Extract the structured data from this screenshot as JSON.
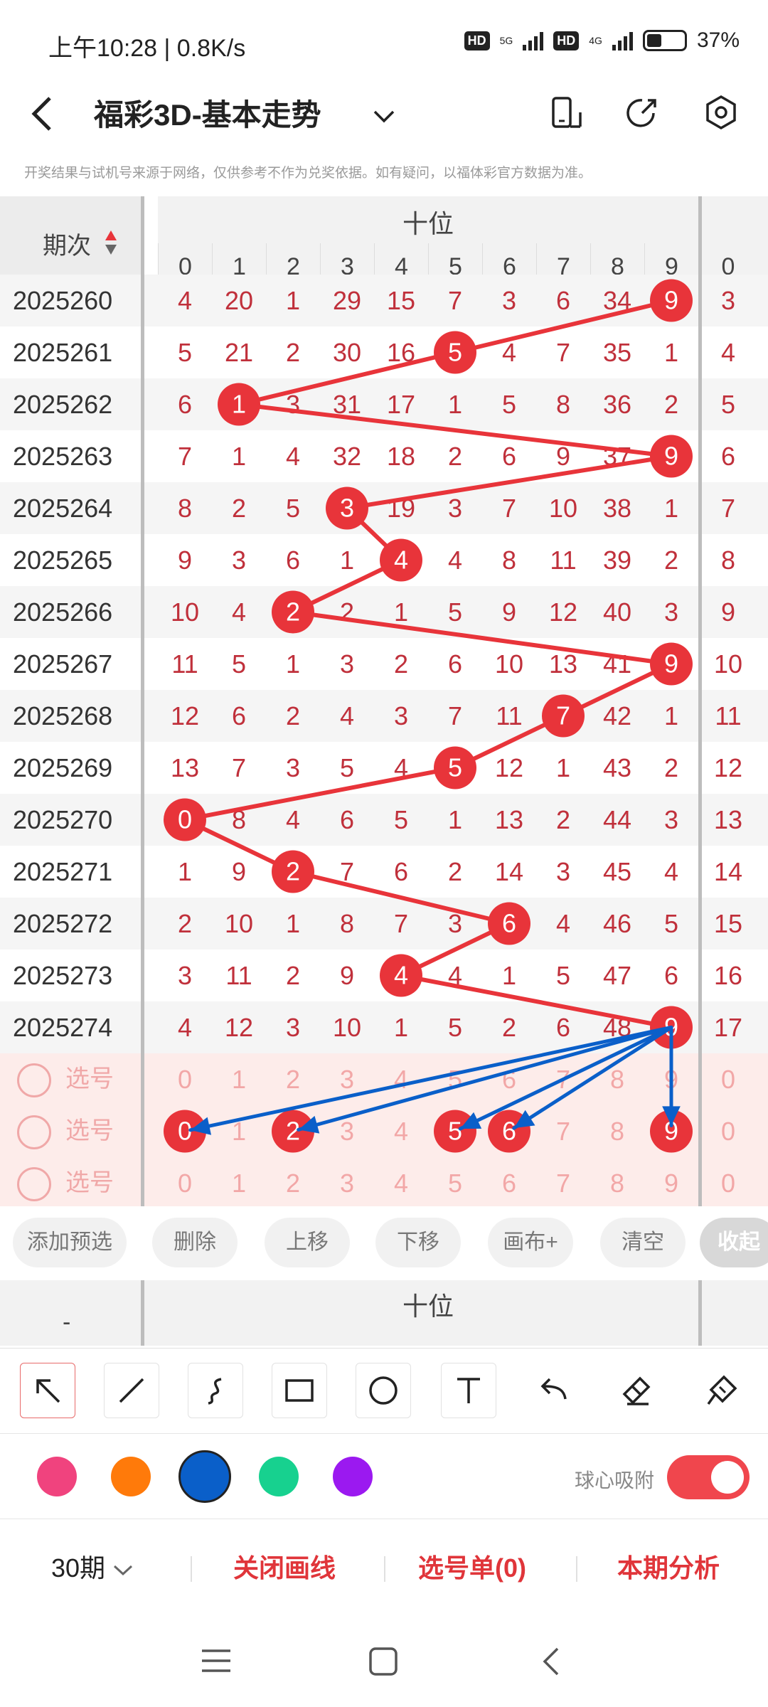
{
  "status": {
    "time": "上午10:28 | 0.8K/s",
    "hd": "HD",
    "net5g": "5G",
    "net4g": "4G",
    "battery": "37%"
  },
  "header": {
    "title": "福彩3D-基本走势"
  },
  "notice": "开奖结果与试机号来源于网络，仅供参考不作为兑奖依据。如有疑问，以福体彩官方数据为准。",
  "table": {
    "period_col_label": "期次",
    "zone_title": "十位",
    "digits": [
      "0",
      "1",
      "2",
      "3",
      "4",
      "5",
      "6",
      "7",
      "8",
      "9"
    ],
    "next_zone_first_digit": "0",
    "rows": [
      {
        "period": "2025260",
        "cells": [
          "4",
          "20",
          "1",
          "29",
          "15",
          "7",
          "3",
          "6",
          "34",
          "9"
        ],
        "extra": "3",
        "hit": 9
      },
      {
        "period": "2025261",
        "cells": [
          "5",
          "21",
          "2",
          "30",
          "16",
          "5",
          "4",
          "7",
          "35",
          "1"
        ],
        "extra": "4",
        "hit": 5
      },
      {
        "period": "2025262",
        "cells": [
          "6",
          "1",
          "3",
          "31",
          "17",
          "1",
          "5",
          "8",
          "36",
          "2"
        ],
        "extra": "5",
        "hit": 1
      },
      {
        "period": "2025263",
        "cells": [
          "7",
          "1",
          "4",
          "32",
          "18",
          "2",
          "6",
          "9",
          "37",
          "9"
        ],
        "extra": "6",
        "hit": 9
      },
      {
        "period": "2025264",
        "cells": [
          "8",
          "2",
          "5",
          "3",
          "19",
          "3",
          "7",
          "10",
          "38",
          "1"
        ],
        "extra": "7",
        "hit": 3
      },
      {
        "period": "2025265",
        "cells": [
          "9",
          "3",
          "6",
          "1",
          "4",
          "4",
          "8",
          "11",
          "39",
          "2"
        ],
        "extra": "8",
        "hit": 4
      },
      {
        "period": "2025266",
        "cells": [
          "10",
          "4",
          "2",
          "2",
          "1",
          "5",
          "9",
          "12",
          "40",
          "3"
        ],
        "extra": "9",
        "hit": 2
      },
      {
        "period": "2025267",
        "cells": [
          "11",
          "5",
          "1",
          "3",
          "2",
          "6",
          "10",
          "13",
          "41",
          "9"
        ],
        "extra": "10",
        "hit": 9
      },
      {
        "period": "2025268",
        "cells": [
          "12",
          "6",
          "2",
          "4",
          "3",
          "7",
          "11",
          "7",
          "42",
          "1"
        ],
        "extra": "11",
        "hit": 7
      },
      {
        "period": "2025269",
        "cells": [
          "13",
          "7",
          "3",
          "5",
          "4",
          "5",
          "12",
          "1",
          "43",
          "2"
        ],
        "extra": "12",
        "hit": 5
      },
      {
        "period": "2025270",
        "cells": [
          "0",
          "8",
          "4",
          "6",
          "5",
          "1",
          "13",
          "2",
          "44",
          "3"
        ],
        "extra": "13",
        "hit": 0
      },
      {
        "period": "2025271",
        "cells": [
          "1",
          "9",
          "2",
          "7",
          "6",
          "2",
          "14",
          "3",
          "45",
          "4"
        ],
        "extra": "14",
        "hit": 2
      },
      {
        "period": "2025272",
        "cells": [
          "2",
          "10",
          "1",
          "8",
          "7",
          "3",
          "6",
          "4",
          "46",
          "5"
        ],
        "extra": "15",
        "hit": 6
      },
      {
        "period": "2025273",
        "cells": [
          "3",
          "11",
          "2",
          "9",
          "4",
          "4",
          "1",
          "5",
          "47",
          "6"
        ],
        "extra": "16",
        "hit": 4
      },
      {
        "period": "2025274",
        "cells": [
          "4",
          "12",
          "3",
          "10",
          "1",
          "5",
          "2",
          "6",
          "48",
          "9"
        ],
        "extra": "17",
        "hit": 9
      }
    ],
    "select_rows": [
      {
        "label": "选号",
        "cells": [
          "0",
          "1",
          "2",
          "3",
          "4",
          "5",
          "6",
          "7",
          "8",
          "9"
        ],
        "extra": "0",
        "picked": []
      },
      {
        "label": "选号",
        "cells": [
          "0",
          "1",
          "2",
          "3",
          "4",
          "5",
          "6",
          "7",
          "8",
          "9"
        ],
        "extra": "0",
        "picked": [
          0,
          2,
          5,
          6,
          9
        ]
      },
      {
        "label": "选号",
        "cells": [
          "0",
          "1",
          "2",
          "3",
          "4",
          "5",
          "6",
          "7",
          "8",
          "9"
        ],
        "extra": "0",
        "picked": []
      }
    ]
  },
  "actions": {
    "add": "添加预选",
    "delete": "删除",
    "up": "上移",
    "down": "下移",
    "canvas": "画布+",
    "clear": "清空",
    "fold": "收起"
  },
  "second_chart": {
    "dash": "-",
    "zone_title": "十位"
  },
  "tools": [
    "pointer-tool",
    "line-tool",
    "curve-tool",
    "rect-tool",
    "circle-tool",
    "text-tool",
    "undo-tool",
    "eraser-tool",
    "clear-brush-tool"
  ],
  "colors": {
    "swatches": [
      "#f0437e",
      "#ff7a0a",
      "#0a5fc9",
      "#17d18f",
      "#9b19f0"
    ],
    "selected": "#0a5fc9",
    "ball": "#e8343a",
    "toggle_on": "#f0464d"
  },
  "snap": {
    "label": "球心吸附",
    "on": true
  },
  "bottom": {
    "periods": "30期",
    "close_lines": "关闭画线",
    "picklist": "选号单(0)",
    "analysis": "本期分析"
  }
}
